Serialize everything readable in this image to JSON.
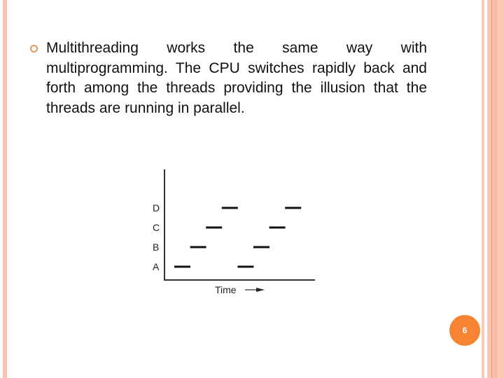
{
  "slide": {
    "bullet_text": "Multithreading works the same way with multiprogramming. The CPU switches rapidly back and forth among the threads providing the illusion that the threads are running in parallel.",
    "slide_number": "6",
    "colors": {
      "accent": "#f78433",
      "stripe": "#f8c5b4",
      "bullet": "#e0985b"
    }
  },
  "diagram": {
    "x_label": "Time",
    "threads": [
      "A",
      "B",
      "C",
      "D"
    ],
    "time_slots": 8,
    "schedule": [
      {
        "thread": "A",
        "slot": 0
      },
      {
        "thread": "B",
        "slot": 1
      },
      {
        "thread": "C",
        "slot": 2
      },
      {
        "thread": "D",
        "slot": 3
      },
      {
        "thread": "A",
        "slot": 4
      },
      {
        "thread": "B",
        "slot": 5
      },
      {
        "thread": "C",
        "slot": 6
      },
      {
        "thread": "D",
        "slot": 7
      }
    ]
  }
}
